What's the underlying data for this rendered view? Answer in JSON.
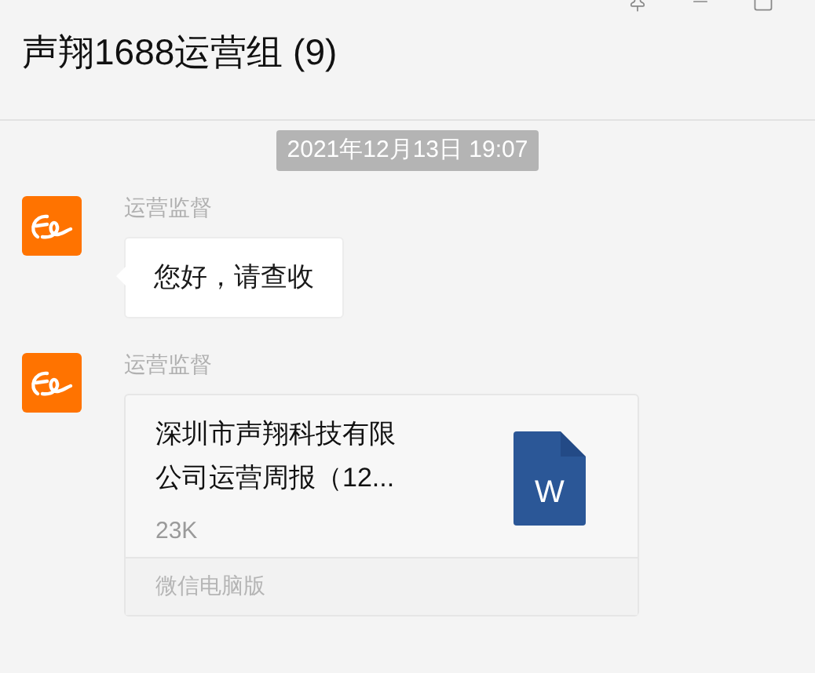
{
  "window": {
    "title": "声翔1688运营组 (9)"
  },
  "date_divider": "2021年12月13日 19:07",
  "messages": [
    {
      "kind": "text",
      "sender": "运营监督",
      "text": "您好，请查收"
    },
    {
      "kind": "file",
      "sender": "运营监督",
      "file_name_lines": [
        "深圳市声翔科技有限",
        "公司运营周报（12..."
      ],
      "file_size": "23K",
      "file_icon_letter": "W",
      "source": "微信电脑版"
    }
  ]
}
